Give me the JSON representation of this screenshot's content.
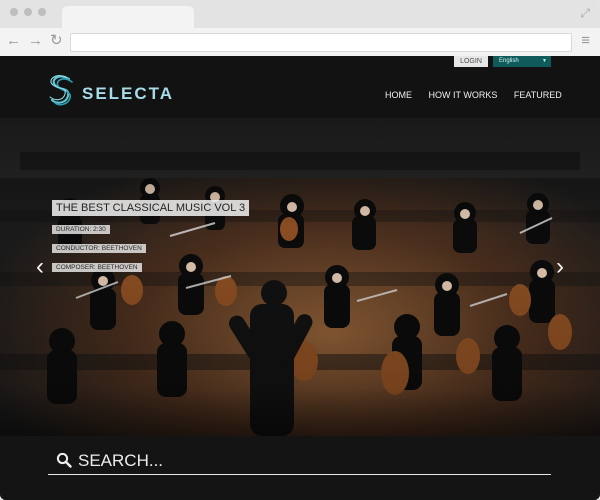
{
  "site": {
    "login_label": "LOGIN",
    "language": "English",
    "brand": "SELECTA",
    "nav": [
      "HOME",
      "HOW IT WORKS",
      "FEATURED"
    ]
  },
  "hero": {
    "title": "THE BEST CLASSICAL MUSIC VOL 3",
    "duration": "DURATION: 2:30",
    "conductor": "CONDUCTOR: BEETHOVEN",
    "composer": "COMPOSER: BEETHOVEN"
  },
  "search": {
    "placeholder": "SEARCH..."
  },
  "colors": {
    "accent_teal": "#0f5a5b",
    "logo_teal": "#a6dce8",
    "background_dark": "#161616"
  },
  "icons": {
    "prev": "chevron-left-icon",
    "next": "chevron-right-icon",
    "search": "search-icon"
  }
}
